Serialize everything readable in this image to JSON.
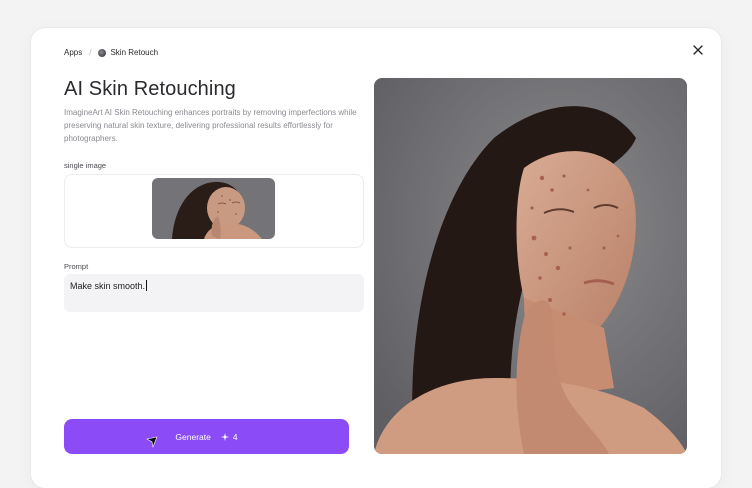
{
  "breadcrumb": {
    "root": "Apps",
    "separator": "/",
    "current": "Skin Retouch"
  },
  "header": {
    "title": "AI Skin Retouching",
    "description": "ImagineArt AI Skin Retouching enhances portraits by removing imperfections while preserving natural skin texture, delivering professional results effortlessly for photographers."
  },
  "upload": {
    "label": "single image"
  },
  "prompt": {
    "label": "Prompt",
    "value": "Make skin smooth."
  },
  "generate": {
    "label": "Generate",
    "credit_icon": "sparkle-icon",
    "credits": "4"
  },
  "icons": {
    "close": "close-icon",
    "app": "app-logo-icon",
    "cursor": "pointer-cursor-icon"
  },
  "colors": {
    "accent": "#8b4cf8",
    "background": "#f3f3f4",
    "preview_bg": "#7a7a7d"
  }
}
